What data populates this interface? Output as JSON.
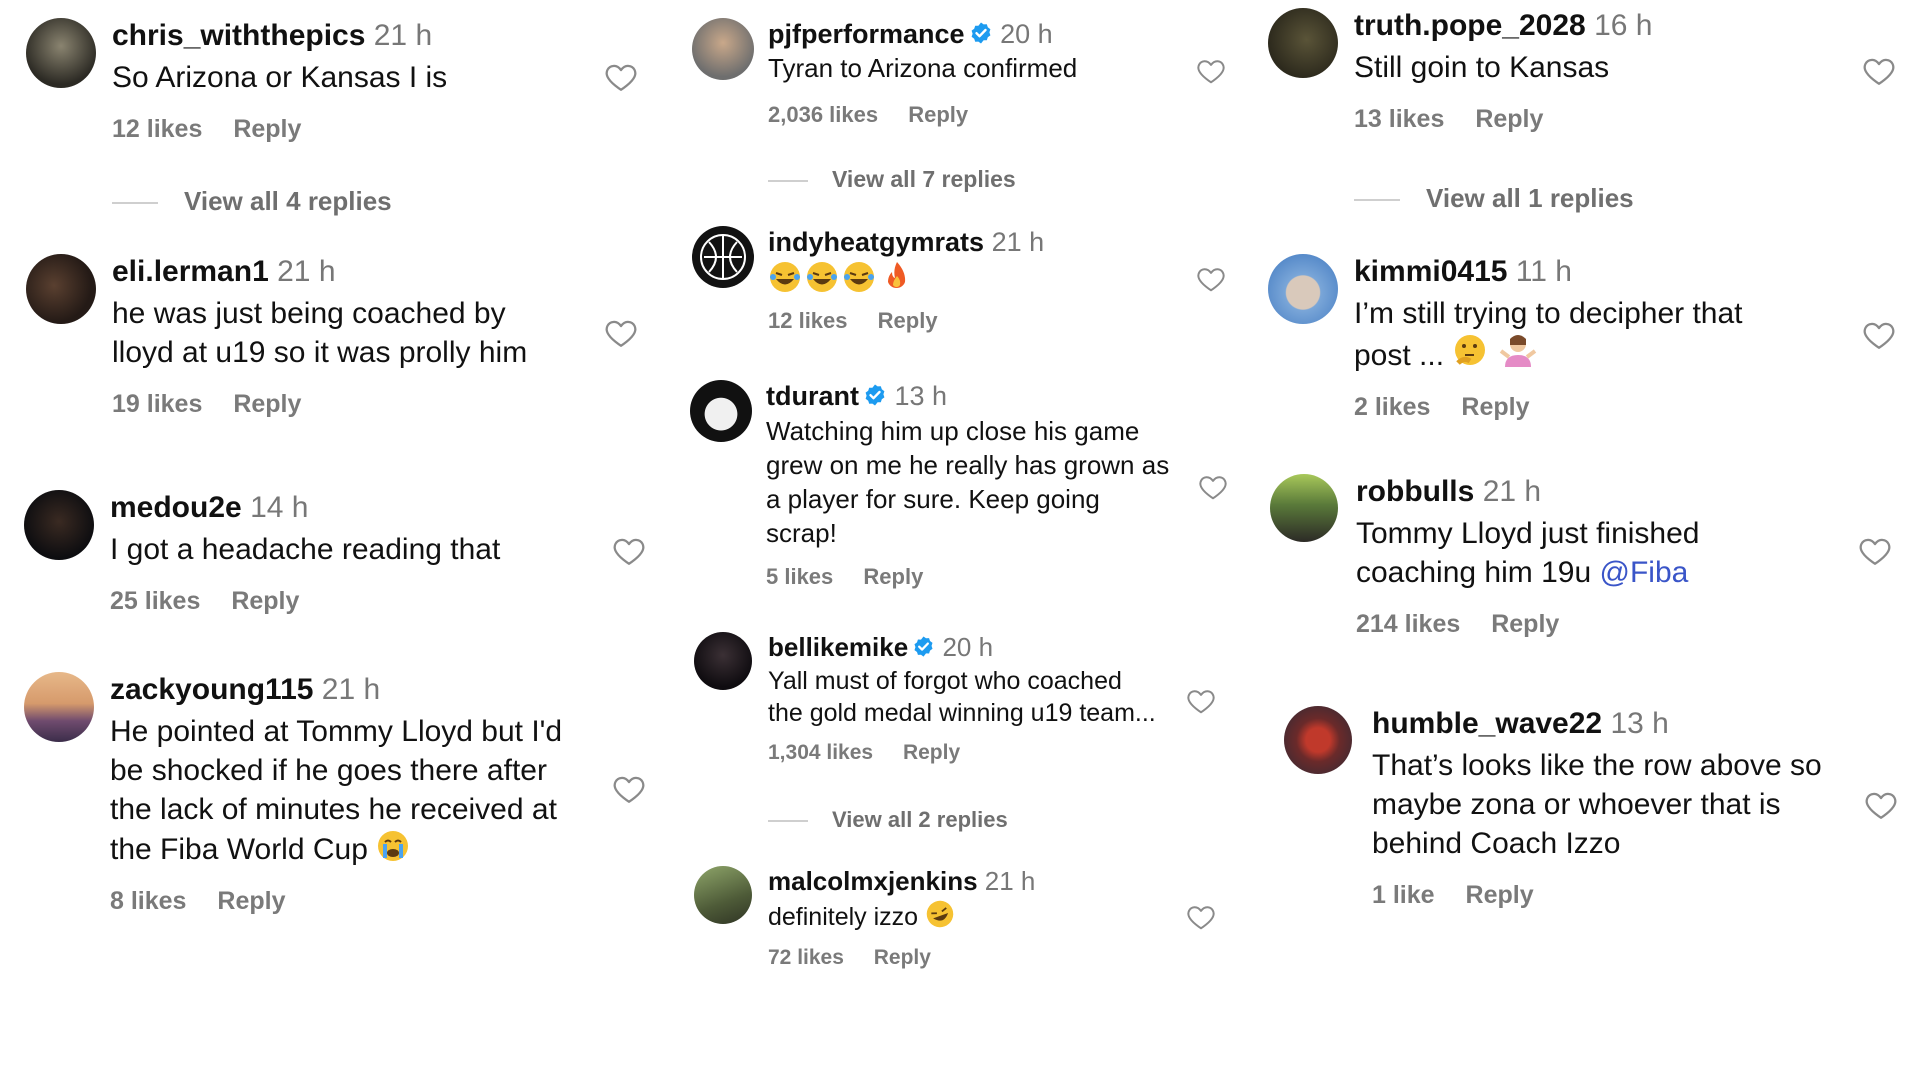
{
  "col1": {
    "c1": {
      "user": "chris_withthepics",
      "time": "21 h",
      "text": "So Arizona or Kansas I is",
      "likes": "12 likes",
      "reply": "Reply"
    },
    "r1": "View all 4 replies",
    "c2": {
      "user": "eli.lerman1",
      "time": "21 h",
      "line1": "he was just being coached by",
      "line2": "lloyd at u19 so it was prolly him",
      "likes": "19 likes",
      "reply": "Reply"
    },
    "c3": {
      "user": "medou2e",
      "time": "14 h",
      "text": "I got a headache reading that",
      "likes": "25 likes",
      "reply": "Reply"
    },
    "c4": {
      "user": "zackyoung115",
      "time": "21 h",
      "line1": "He pointed at Tommy Lloyd but I'd",
      "line2": "be shocked if he goes there after",
      "line3": "the lack of minutes he received at",
      "line4": "the Fiba World Cup",
      "likes": "8 likes",
      "reply": "Reply"
    }
  },
  "col2": {
    "c1": {
      "user": "pjfperformance",
      "time": "20 h",
      "text": "Tyran to Arizona confirmed",
      "likes": "2,036 likes",
      "reply": "Reply"
    },
    "r1": "View all 7 replies",
    "c2": {
      "user": "indyheatgymrats",
      "time": "21 h",
      "likes": "12 likes",
      "reply": "Reply"
    },
    "c3": {
      "user": "tdurant",
      "time": "13 h",
      "line1": "Watching him up close his game",
      "line2": "grew on me he really has grown as",
      "line3": "a player for sure. Keep going",
      "line4": "scrap!",
      "likes": "5 likes",
      "reply": "Reply"
    },
    "c4": {
      "user": "bellikemike",
      "time": "20 h",
      "line1": "Yall must of forgot who coached",
      "line2": "the gold medal winning u19 team...",
      "likes": "1,304 likes",
      "reply": "Reply"
    },
    "r2": "View all 2 replies",
    "c5": {
      "user": "malcolmxjenkins",
      "time": "21 h",
      "text": "definitely izzo",
      "likes": "72 likes",
      "reply": "Reply"
    }
  },
  "col3": {
    "c1": {
      "user": "truth.pope_2028",
      "time": "16 h",
      "text": "Still goin to Kansas",
      "likes": "13 likes",
      "reply": "Reply"
    },
    "r1": "View all 1 replies",
    "c2": {
      "user": "kimmi0415",
      "time": "11 h",
      "line1": "I’m still trying to decipher that",
      "line2": "post ...",
      "likes": "2 likes",
      "reply": "Reply"
    },
    "c3": {
      "user": "robbulls",
      "time": "21 h",
      "line1": "Tommy Lloyd just finished",
      "line2": "coaching him 19u",
      "mention": "@Fiba",
      "likes": "214 likes",
      "reply": "Reply"
    },
    "c4": {
      "user": "humble_wave22",
      "time": "13 h",
      "line1": "That’s looks like the row above so",
      "line2": "maybe zona or whoever that is",
      "line3": "behind Coach Izzo",
      "likes": "1 like",
      "reply": "Reply"
    }
  },
  "colors": {
    "mention": "#3a55c8",
    "verified": "#1d9bf0",
    "meta": "#7a7a7a",
    "divider": "#cfcfcf"
  },
  "icons": [
    "heart-icon",
    "verified-badge-icon",
    "avatar"
  ]
}
